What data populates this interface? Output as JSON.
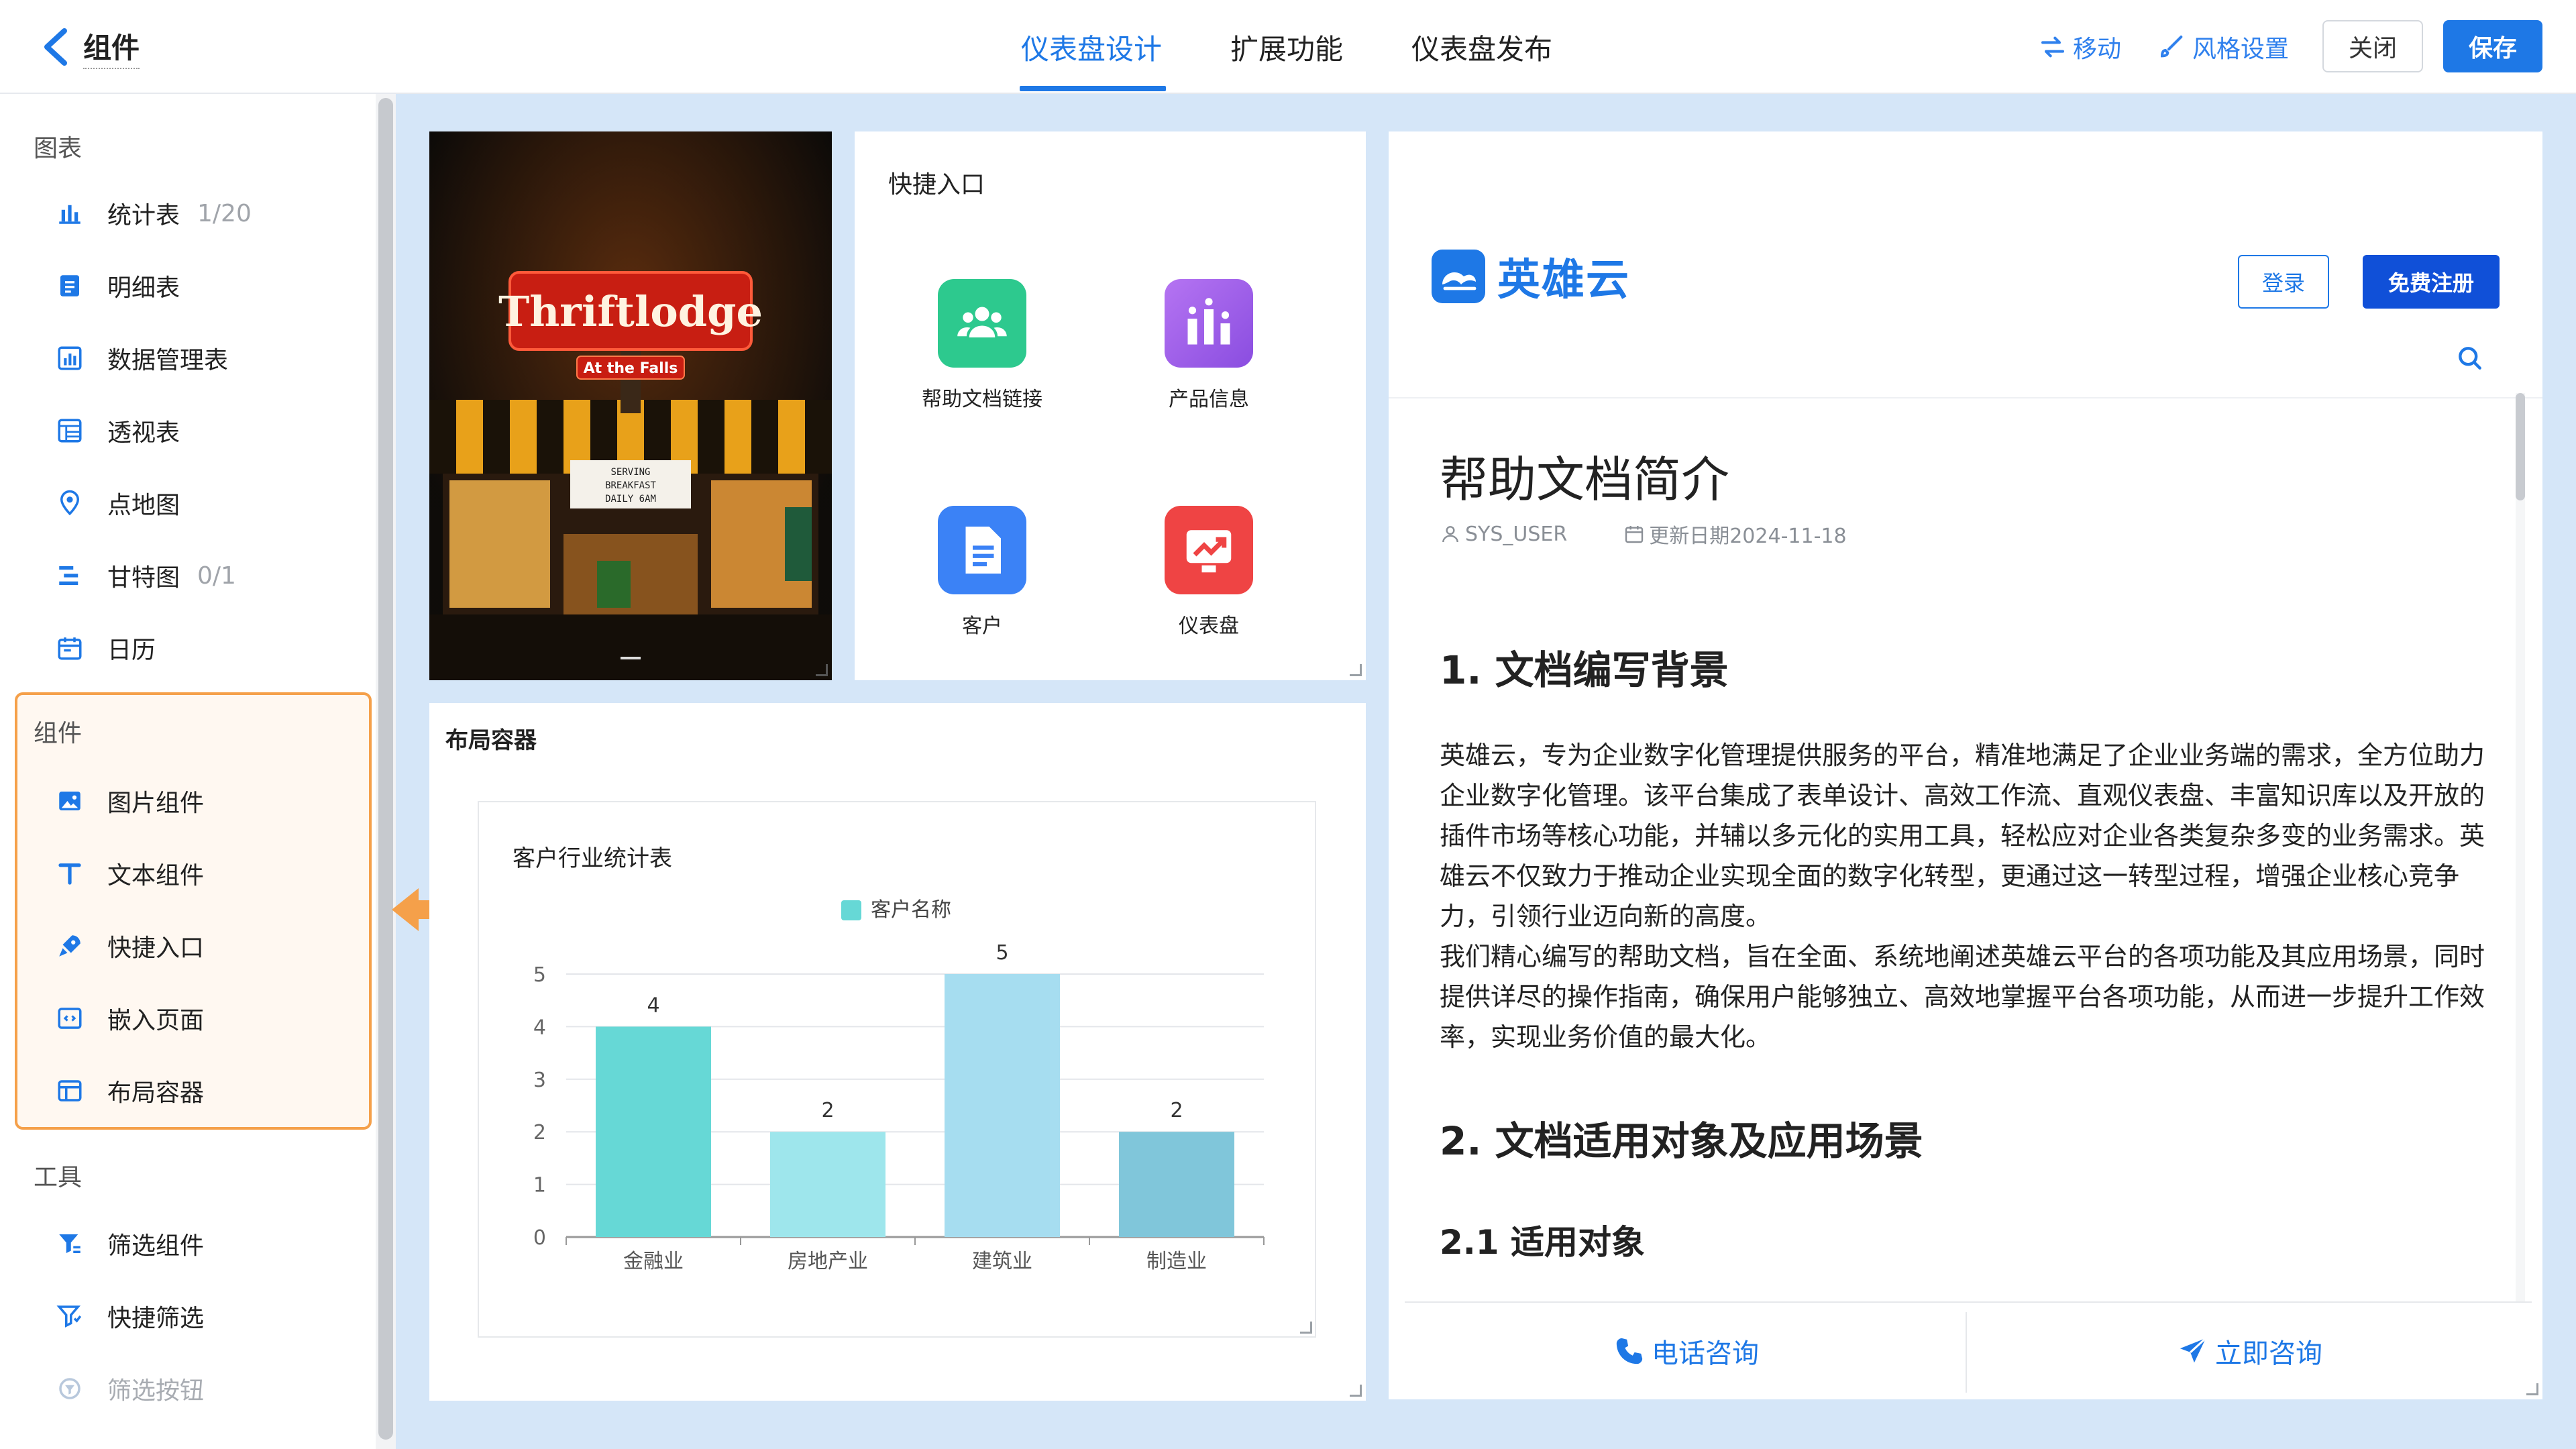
{
  "header": {
    "back_label": "组件",
    "tabs": [
      {
        "label": "仪表盘设计",
        "active": true
      },
      {
        "label": "扩展功能"
      },
      {
        "label": "仪表盘发布"
      }
    ],
    "actions": {
      "move": "移动",
      "style": "风格设置",
      "close": "关闭",
      "save": "保存"
    },
    "accent": "#1e78e6"
  },
  "sidebar": {
    "sections": [
      {
        "title": "图表",
        "items": [
          {
            "label": "统计表",
            "count": "1/20",
            "icon": "bar-chart-icon"
          },
          {
            "label": "明细表",
            "icon": "detail-table-icon"
          },
          {
            "label": "数据管理表",
            "icon": "data-table-icon"
          },
          {
            "label": "透视表",
            "icon": "pivot-table-icon"
          },
          {
            "label": "点地图",
            "icon": "map-pin-icon"
          },
          {
            "label": "甘特图",
            "count": "0/1",
            "icon": "gantt-icon"
          },
          {
            "label": "日历",
            "icon": "calendar-icon"
          }
        ]
      },
      {
        "title": "组件",
        "items": [
          {
            "label": "图片组件",
            "icon": "image-icon"
          },
          {
            "label": "文本组件",
            "icon": "text-icon"
          },
          {
            "label": "快捷入口",
            "icon": "rocket-icon"
          },
          {
            "label": "嵌入页面",
            "icon": "embed-icon"
          },
          {
            "label": "布局容器",
            "icon": "layout-icon"
          }
        ]
      },
      {
        "title": "工具",
        "items": [
          {
            "label": "筛选组件",
            "icon": "filter-icon"
          },
          {
            "label": "快捷筛选",
            "icon": "quick-filter-icon"
          },
          {
            "label": "筛选按钮",
            "icon": "filter-button-icon",
            "disabled": true
          }
        ]
      }
    ],
    "highlight_color": "#f5a04a"
  },
  "image_card": {
    "sign_text": "Thriftlodge",
    "sub_sign": "At the Falls",
    "marquee": [
      "SERVING",
      "BREAKFAST",
      "DAILY 6AM"
    ]
  },
  "quick_entry": {
    "title": "快捷入口",
    "items": [
      {
        "label": "帮助文档链接",
        "color": "#2dc98e",
        "icon": "users-icon"
      },
      {
        "label": "产品信息",
        "color": "#9b5de5",
        "icon": "product-icon"
      },
      {
        "label": "客户",
        "color": "#3b82f6",
        "icon": "document-icon"
      },
      {
        "label": "仪表盘",
        "color": "#ef4444",
        "icon": "trend-chart-icon"
      }
    ]
  },
  "layout_container": {
    "title": "布局容器"
  },
  "chart_data": {
    "type": "bar",
    "title": "客户行业统计表",
    "categories": [
      "金融业",
      "房地产业",
      "建筑业",
      "制造业"
    ],
    "series": [
      {
        "name": "客户名称",
        "values": [
          4,
          2,
          5,
          2
        ]
      }
    ],
    "bar_colors": [
      "#66d8d6",
      "#9ee6ec",
      "#a6ddf0",
      "#80c6da"
    ],
    "legend_color": "#66d8d6",
    "ylim": [
      0,
      5
    ],
    "yticks": [
      0,
      1,
      2,
      3,
      4,
      5
    ],
    "legend_position": "top-center",
    "data_labels": true
  },
  "right_panel": {
    "brand": "英雄云",
    "login": "登录",
    "register": "免费注册",
    "doc_title": "帮助文档简介",
    "author": "SYS_USER",
    "updated": "更新日期2024-11-18",
    "h1": "1. 文档编写背景",
    "paragraph1": "英雄云，专为企业数字化管理提供服务的平台，精准地满足了企业业务端的需求，全方位助力企业数字化管理。该平台集成了表单设计、高效工作流、直观仪表盘、丰富知识库以及开放的插件市场等核心功能，并辅以多元化的实用工具，轻松应对企业各类复杂多变的业务需求。英雄云不仅致力于推动企业实现全面的数字化转型，更通过这一转型过程，增强企业核心竞争力，引领行业迈向新的高度。",
    "paragraph2": "我们精心编写的帮助文档，旨在全面、系统地阐述英雄云平台的各项功能及其应用场景，同时提供详尽的操作指南，确保用户能够独立、高效地掌握平台各项功能，从而进一步提升工作效率，实现业务价值的最大化。",
    "h2": "2. 文档适用对象及应用场景",
    "h3": "2.1 适用对象",
    "phone_consult": "电话咨询",
    "instant_consult": "立即咨询"
  }
}
